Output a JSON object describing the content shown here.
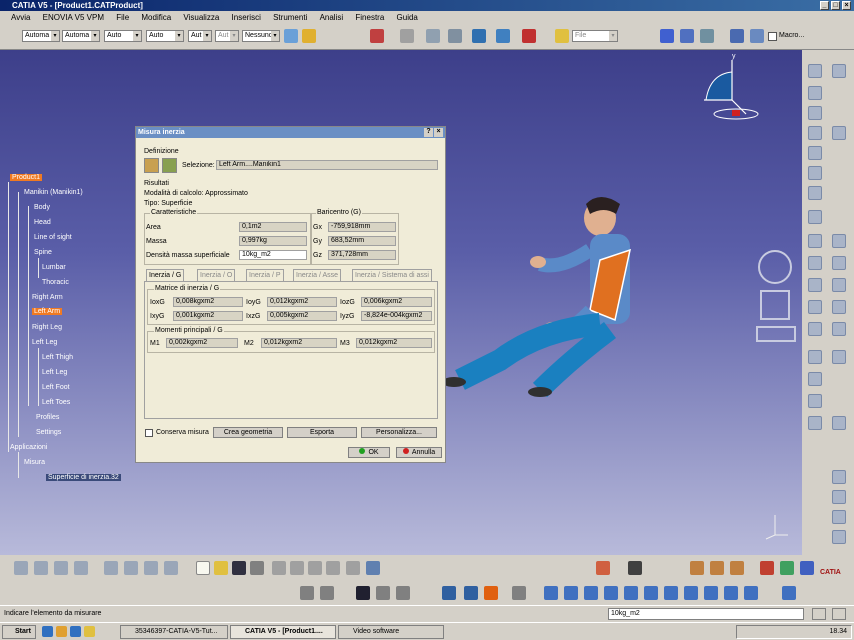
{
  "window": {
    "title": "CATIA V5 - [Product1.CATProduct]"
  },
  "menu": [
    "Avvia",
    "ENOVIA V5 VPM",
    "File",
    "Modifica",
    "Visualizza",
    "Inserisci",
    "Strumenti",
    "Analisi",
    "Finestra",
    "Guida"
  ],
  "toolbar": {
    "combos": [
      "Automa",
      "Automa",
      "Auto",
      "Auto",
      "Aut",
      "Aut",
      "Nessuno"
    ],
    "file_combo": "File",
    "macro_label": "Macro..."
  },
  "tree": {
    "product": "Product1",
    "manikin": "Manikin (Manikin1)",
    "body": "Body",
    "head": "Head",
    "line_of_sight": "Line of sight",
    "spine": "Spine",
    "lumbar": "Lumbar",
    "thoracic": "Thoracic",
    "right_arm": "Right Arm",
    "left_arm": "Left Arm",
    "right_leg": "Right Leg",
    "left_leg": "Left Leg",
    "left_thigh": "Left Thigh",
    "left_leg2": "Left Leg",
    "left_foot": "Left Foot",
    "left_toes": "Left Toes",
    "profiles": "Profiles",
    "settings": "Settings",
    "applicazioni": "Applicazioni",
    "misura": "Misura",
    "superficie": "Superficie di inerzia.32"
  },
  "dialog": {
    "title": "Misura inerzia",
    "help": "?",
    "close": "×",
    "definizione": "Definizione",
    "selezione_label": "Selezione:",
    "selezione_value": "Left Arm....Manikin1",
    "risultati": "Risultati",
    "modalita": "Modalità di calcolo:  Approssimato",
    "tipo": "Tipo:  Superficie",
    "caratteristiche": "Caratteristiche",
    "area_label": "Area",
    "area_value": "0,1m2",
    "massa_label": "Massa",
    "massa_value": "0,997kg",
    "densita_label": "Densità massa superficiale",
    "densita_value": "10kg_m2",
    "baricentro": "Baricentro (G)",
    "gx_label": "Gx",
    "gx_value": "-759,918mm",
    "gy_label": "Gy",
    "gy_value": "683,52mm",
    "gz_label": "Gz",
    "gz_value": "371,728mm",
    "tabs": [
      "Inerzia / G",
      "Inerzia / O",
      "Inerzia / P",
      "Inerzia / Asse",
      "Inerzia / Sistema di assi"
    ],
    "matrice": "Matrice di inerzia / G",
    "ioxg_label": "IoxG",
    "ioxg_value": "0,008kgxm2",
    "ioyg_label": "IoyG",
    "ioyg_value": "0,012kgxm2",
    "iozg_label": "IozG",
    "iozg_value": "0,006kgxm2",
    "ixyg_label": "IxyG",
    "ixyg_value": "0,001kgxm2",
    "ixzg_label": "IxzG",
    "ixzg_value": "0,005kgxm2",
    "iyzg_label": "IyzG",
    "iyzg_value": "-8,824e-004kgxm2",
    "momenti": "Momenti principali / G",
    "m1_label": "M1",
    "m1_value": "0,002kgxm2",
    "m2_label": "M2",
    "m2_value": "0,012kgxm2",
    "m3_label": "M3",
    "m3_value": "0,012kgxm2",
    "conserva": "Conserva misura",
    "crea": "Crea geometria",
    "esporta": "Esporta",
    "personalizza": "Personalizza...",
    "ok": "OK",
    "annulla": "Annulla"
  },
  "status": {
    "message": "Indicare l'elemento da misurare",
    "input": "10kg_m2"
  },
  "taskbar": {
    "start": "Start",
    "tasks": [
      "35346397-CATIA-V5-Tut...",
      "CATIA V5 - [Product1....",
      "Video software"
    ],
    "clock": "18.34"
  },
  "compass_label": "y",
  "catia_logo": "CATIA",
  "colors": {
    "viewport_top": "#3d3f8a",
    "selection_orange": "#f07a22",
    "dialog_bg": "#f0ecd8"
  }
}
